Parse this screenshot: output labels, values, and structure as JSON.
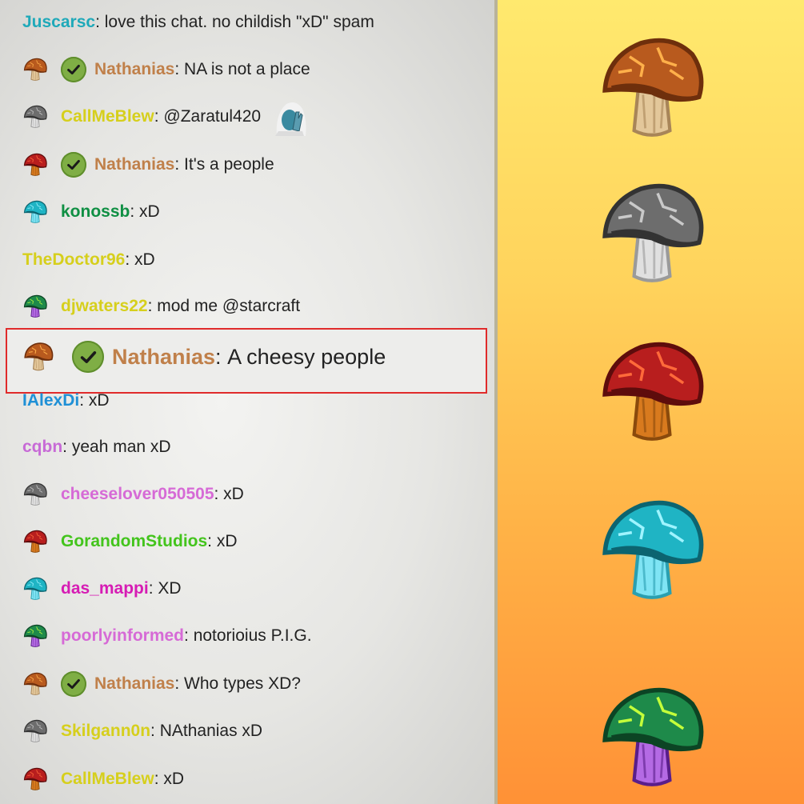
{
  "chat": {
    "messages": [
      {
        "user": "Juscarsc",
        "text": "love this chat. no childish \"xD\" spam",
        "user_color": "#1fa9b9",
        "badge": "none",
        "verified": false
      },
      {
        "user": "Nathanias",
        "text": "NA is not a place",
        "user_color": "#c0804a",
        "badge": "orange",
        "verified": true
      },
      {
        "user": "CallMeBlew",
        "text": "@Zaratul420",
        "user_color": "#d6cf1c",
        "badge": "gray",
        "verified": false,
        "emote": "facepalm-emote"
      },
      {
        "user": "Nathanias",
        "text": "It's a people",
        "user_color": "#c0804a",
        "badge": "red",
        "verified": true
      },
      {
        "user": "konossb",
        "text": "xD",
        "user_color": "#0f8f43",
        "badge": "teal",
        "verified": false
      },
      {
        "user": "TheDoctor96",
        "text": "xD",
        "user_color": "#d6cf1c",
        "badge": "none",
        "verified": false
      },
      {
        "user": "djwaters22",
        "text": "mod me @starcraft",
        "user_color": "#d6cf1c",
        "badge": "green",
        "verified": false
      },
      {
        "user": "IAlexDi",
        "text": "xD",
        "user_color": "#1f90d6",
        "badge": "none",
        "verified": false
      },
      {
        "user": "cqbn",
        "text": "yeah man xD",
        "user_color": "#c76ad6",
        "badge": "none",
        "verified": false
      },
      {
        "user": "cheeselover050505",
        "text": "xD",
        "user_color": "#d66ad6",
        "badge": "gray",
        "verified": false
      },
      {
        "user": "GorandomStudios",
        "text": "xD",
        "user_color": "#43c41c",
        "badge": "red",
        "verified": false
      },
      {
        "user": "das_mappi",
        "text": "XD",
        "user_color": "#d61cb4",
        "badge": "teal",
        "verified": false
      },
      {
        "user": "poorlyinformed",
        "text": "notorioius P.I.G.",
        "user_color": "#d66ad6",
        "badge": "green",
        "verified": false
      },
      {
        "user": "Nathanias",
        "text": "Who types XD?",
        "user_color": "#c0804a",
        "badge": "orange",
        "verified": true
      },
      {
        "user": "Skilgann0n",
        "text": "NAthanias xD",
        "user_color": "#d6cf1c",
        "badge": "gray",
        "verified": false
      },
      {
        "user": "CallMeBlew",
        "text": "xD",
        "user_color": "#d6cf1c",
        "badge": "red",
        "verified": false
      }
    ],
    "highlighted": {
      "user": "Nathanias",
      "text": "A cheesy people",
      "user_color": "#c0804a",
      "badge": "orange",
      "verified": true
    },
    "separator": ": "
  },
  "badge_panel": {
    "badges": [
      "orange",
      "gray",
      "red",
      "teal",
      "green"
    ]
  },
  "colors": {
    "orange": {
      "cap": "#b85a1e",
      "dark": "#6e2f0c",
      "vein": "#ffb04a",
      "stem": "#e3c79a",
      "stem_dark": "#a88558"
    },
    "gray": {
      "cap": "#6d6d6d",
      "dark": "#333333",
      "vein": "#c9c9c9",
      "stem": "#e0e0e0",
      "stem_dark": "#9a9a9a"
    },
    "red": {
      "cap": "#b81e1e",
      "dark": "#5e0c0c",
      "vein": "#ff6a3a",
      "stem": "#d87a1e",
      "stem_dark": "#8a4a0c"
    },
    "teal": {
      "cap": "#1fb4c4",
      "dark": "#0c6470",
      "vein": "#9ff4ff",
      "stem": "#7fe4f4",
      "stem_dark": "#2a9fb0"
    },
    "green": {
      "cap": "#1e8a4a",
      "dark": "#0c4424",
      "vein": "#c4ff3a",
      "stem": "#b46ae4",
      "stem_dark": "#5a1e8a"
    },
    "verified": "#7fae45",
    "highlight_border": "#e02b2b"
  }
}
